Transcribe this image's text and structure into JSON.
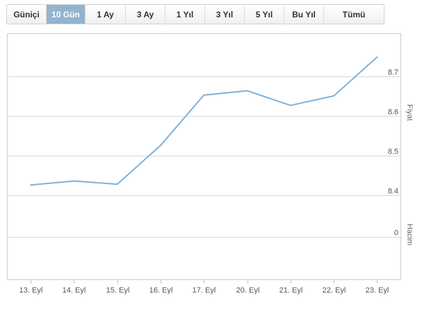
{
  "range_selector": {
    "tabs": [
      {
        "label": "Güniçi",
        "active": false
      },
      {
        "label": "10 Gün",
        "active": true
      },
      {
        "label": "1 Ay",
        "active": false
      },
      {
        "label": "3 Ay",
        "active": false
      },
      {
        "label": "1 Yıl",
        "active": false
      },
      {
        "label": "3 Yıl",
        "active": false
      },
      {
        "label": "5 Yıl",
        "active": false
      },
      {
        "label": "Bu Yıl",
        "active": false
      },
      {
        "label": "Tümü",
        "active": false
      }
    ]
  },
  "colors": {
    "line": "#7cb1dd",
    "grid": "#d8d8d8",
    "active_tab": "#93b3cf"
  },
  "chart_data": {
    "type": "line",
    "categories": [
      "13. Eyl",
      "14. Eyl",
      "15. Eyl",
      "16. Eyl",
      "17. Eyl",
      "20. Eyl",
      "21. Eyl",
      "22. Eyl",
      "23. Eyl"
    ],
    "series": [
      {
        "values": [
          8.425,
          8.435,
          8.427,
          8.525,
          8.652,
          8.663,
          8.626,
          8.65,
          8.748
        ]
      }
    ],
    "price_axis": {
      "title": "Fiyat",
      "ticks": [
        "8.4",
        "8.5",
        "8.6",
        "8.7"
      ],
      "ylim": [
        8.4,
        8.7
      ],
      "position": "right"
    },
    "volume_axis": {
      "title": "Hacim",
      "ticks": [
        "0"
      ],
      "position": "right"
    },
    "grid": true
  }
}
